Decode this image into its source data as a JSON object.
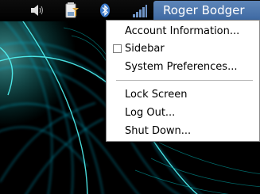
{
  "topbar": {
    "tray_icons": [
      "volume-icon",
      "battery-icon",
      "bluetooth-icon",
      "wifi-icon"
    ],
    "user_name": "Roger Bodger",
    "accent_color": "#4a74ab"
  },
  "menu": {
    "items": [
      {
        "label": "Account Information..."
      },
      {
        "label": "Sidebar",
        "checkbox": true,
        "checked": false
      },
      {
        "label": "System Preferences..."
      },
      {
        "label": "Lock Screen"
      },
      {
        "label": "Log Out..."
      },
      {
        "label": "Shut Down..."
      }
    ]
  },
  "wallpaper": {
    "colors": [
      "#000000",
      "#00c8c8",
      "#7fffff"
    ]
  }
}
